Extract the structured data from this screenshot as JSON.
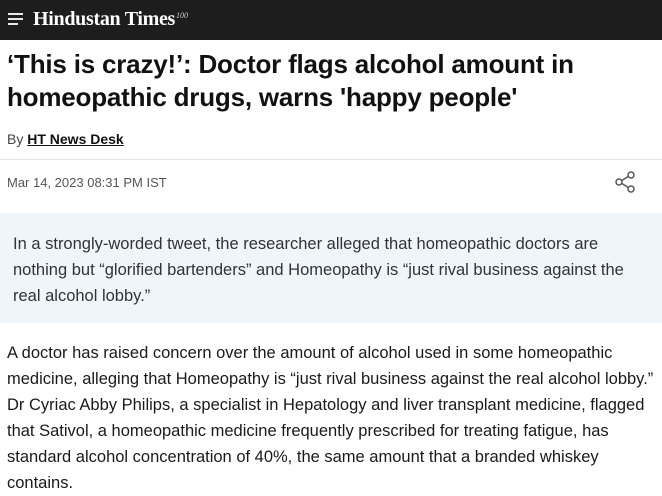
{
  "header": {
    "logo_text": "Hindustan Times",
    "logo_badge": "100"
  },
  "article": {
    "headline": "‘This is crazy!’: Doctor flags alcohol amount in homeopathic drugs, warns 'happy people'",
    "byline_prefix": "By",
    "author": "HT News Desk",
    "date": "Mar 14, 2023 08:31 PM IST",
    "summary": "In a strongly-worded tweet, the researcher alleged that homeopathic doctors are nothing but “glorified bartenders” and Homeopathy is “just rival business against the real alcohol lobby.”",
    "body": "A doctor has raised concern over the amount of alcohol used in some homeopathic medicine, alleging that Homeopathy is “just rival business against the real alcohol lobby.” Dr Cyriac Abby Philips, a specialist in Hepatology and liver transplant medicine, flagged that Sativol, a homeopathic medicine frequently prescribed for treating fatigue, has standard alcohol concentration of 40%, the same amount that a branded whiskey contains."
  },
  "icons": {
    "menu": "hamburger-menu-icon",
    "share": "share-icon"
  },
  "colors": {
    "topbar": "#1d1d1d",
    "summary_bg": "#eef5fb",
    "text": "#1a1a1a"
  }
}
